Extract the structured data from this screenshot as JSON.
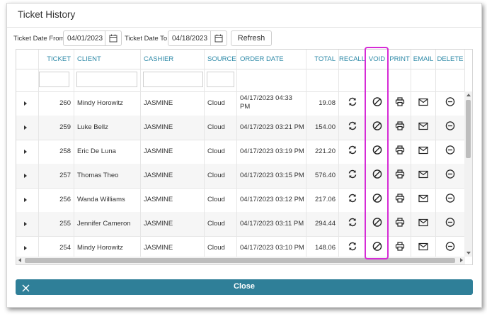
{
  "dialog": {
    "title": "Ticket History"
  },
  "filters": {
    "from_label": "Ticket Date From:",
    "from_value": "04/01/2023",
    "to_label": "Ticket Date To:",
    "to_value": "04/18/2023",
    "refresh_label": "Refresh"
  },
  "grid": {
    "columns": {
      "ticket": "TICKET",
      "client": "CLIENT",
      "cashier": "CASHIER",
      "source": "SOURCE",
      "order_date": "ORDER DATE",
      "total": "TOTAL",
      "recall": "RECALL",
      "void": "VOID",
      "print": "PRINT",
      "email": "EMAIL",
      "delete": "DELETE"
    },
    "rows": [
      {
        "ticket": "260",
        "client": "Mindy Horowitz",
        "cashier": "JASMINE",
        "source": "Cloud",
        "order_date": "04/17/2023 04:33 PM",
        "total": "19.08"
      },
      {
        "ticket": "259",
        "client": "Luke Bellz",
        "cashier": "JASMINE",
        "source": "Cloud",
        "order_date": "04/17/2023 03:21 PM",
        "total": "154.00"
      },
      {
        "ticket": "258",
        "client": "Eric De Luna",
        "cashier": "JASMINE",
        "source": "Cloud",
        "order_date": "04/17/2023 03:19 PM",
        "total": "221.20"
      },
      {
        "ticket": "257",
        "client": "Thomas Theo",
        "cashier": "JASMINE",
        "source": "Cloud",
        "order_date": "04/17/2023 03:15 PM",
        "total": "576.40"
      },
      {
        "ticket": "256",
        "client": "Wanda Williams",
        "cashier": "JASMINE",
        "source": "Cloud",
        "order_date": "04/17/2023 03:12 PM",
        "total": "217.06"
      },
      {
        "ticket": "255",
        "client": "Jennifer Cameron",
        "cashier": "JASMINE",
        "source": "Cloud",
        "order_date": "04/17/2023 03:11 PM",
        "total": "294.44"
      },
      {
        "ticket": "254",
        "client": "Mindy Horowitz",
        "cashier": "JASMINE",
        "source": "Cloud",
        "order_date": "04/17/2023 03:10 PM",
        "total": "148.06"
      }
    ]
  },
  "footer": {
    "close_label": "Close"
  },
  "icons": {
    "calendar": "calendar-icon",
    "recall": "recall-icon",
    "void": "void-icon",
    "print": "printer-icon",
    "email": "envelope-icon",
    "delete": "minus-circle-icon",
    "close": "close-icon"
  },
  "colors": {
    "accent": "#2f7f98",
    "header_text": "#2f8aa8",
    "highlight": "#d62bd6"
  }
}
